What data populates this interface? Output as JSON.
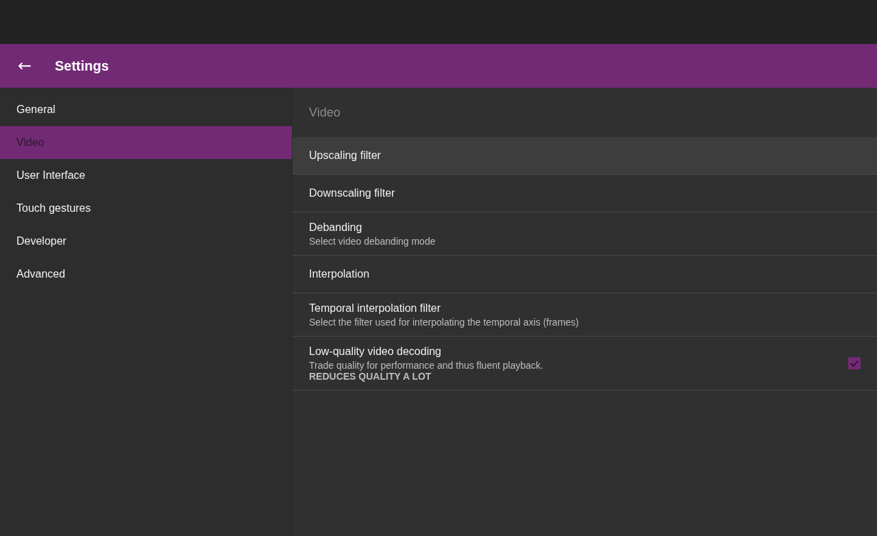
{
  "toolbar": {
    "back_label": "←",
    "title": "Settings"
  },
  "sidebar": {
    "items": [
      {
        "label": "General",
        "selected": false
      },
      {
        "label": "Video",
        "selected": true
      },
      {
        "label": "User Interface",
        "selected": false
      },
      {
        "label": "Touch gestures",
        "selected": false
      },
      {
        "label": "Developer",
        "selected": false
      },
      {
        "label": "Advanced",
        "selected": false
      }
    ]
  },
  "panel": {
    "heading": "Video",
    "preferences": [
      {
        "kind": "plain",
        "title": "Upscaling filter",
        "focused": true
      },
      {
        "kind": "plain",
        "title": "Downscaling filter",
        "focused": false
      },
      {
        "kind": "plain",
        "title": "Debanding",
        "summary": "Select video debanding mode",
        "focused": false
      },
      {
        "kind": "plain",
        "title": "Interpolation",
        "focused": false
      },
      {
        "kind": "plain",
        "title": "Temporal interpolation filter",
        "summary": "Select the filter used for interpolating the temporal axis (frames)",
        "focused": false
      },
      {
        "kind": "checkbox",
        "title": "Low-quality video decoding",
        "summary": "Trade quality for performance and thus fluent playback.\n**REDUCES QUALITY A LOT**",
        "checked": true,
        "focused": false
      }
    ]
  }
}
